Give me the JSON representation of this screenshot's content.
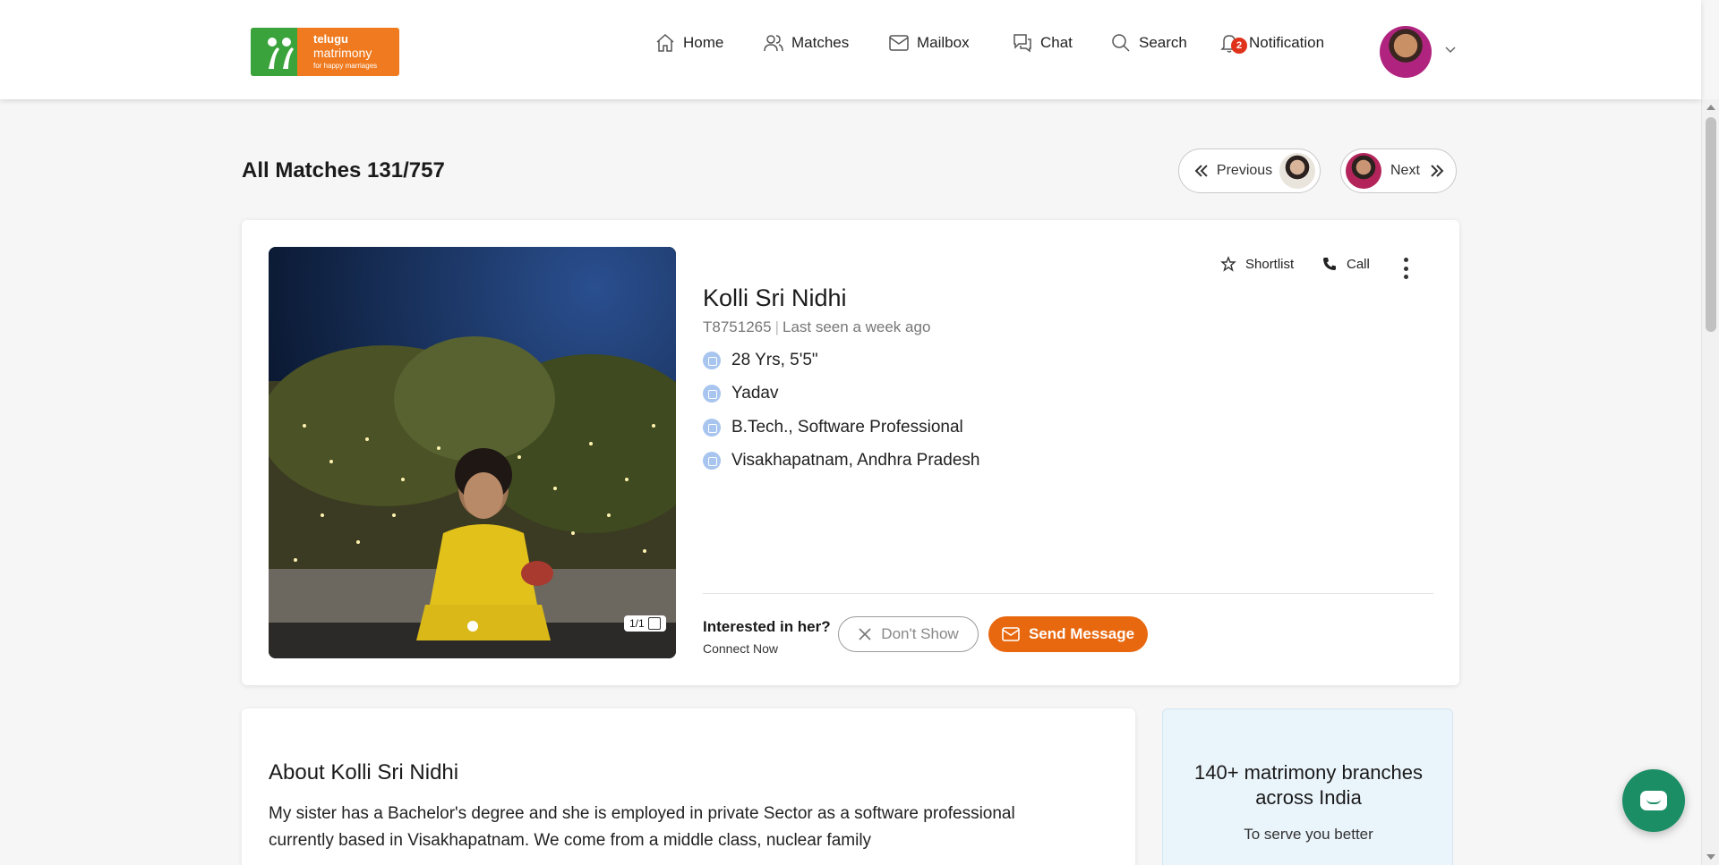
{
  "logo": {
    "line1": "telugu",
    "line2": "matrimony",
    "line3": "for happy marriages"
  },
  "nav": [
    {
      "label": "Home",
      "icon": "home-icon"
    },
    {
      "label": "Matches",
      "icon": "users-icon"
    },
    {
      "label": "Mailbox",
      "icon": "mail-icon"
    },
    {
      "label": "Chat",
      "icon": "chat-icon"
    },
    {
      "label": "Search",
      "icon": "search-icon"
    },
    {
      "label": "Notification",
      "icon": "bell-icon",
      "badge": "2"
    }
  ],
  "matches": {
    "title": "All Matches 131/757",
    "previous": "Previous",
    "next": "Next"
  },
  "profile": {
    "name": "Kolli Sri Nidhi",
    "id": "T8751265",
    "last_seen": "Last seen a week ago",
    "age_height": "28 Yrs, 5'5\"",
    "caste": "Yadav",
    "education": "B.Tech., Software Professional",
    "location": "Visakhapatnam, Andhra Pradesh",
    "photo_count": "1/1",
    "shortlist": "Shortlist",
    "call": "Call",
    "interested": "Interested in her?",
    "connect": "Connect Now",
    "dont_show": "Don't Show",
    "send_message": "Send Message"
  },
  "about": {
    "title": "About Kolli Sri Nidhi",
    "text": "My sister has a Bachelor's degree and she is employed in private Sector as a software professional currently based in Visakhapatnam. We come from a middle class, nuclear family"
  },
  "branch": {
    "title": "140+ matrimony branches across India",
    "subtitle": "To serve you better"
  },
  "colors": {
    "accent": "#e8680f",
    "brand_green": "#3aa33c",
    "brand_orange": "#ef7a1f",
    "chat_fab": "#1b8e66"
  }
}
